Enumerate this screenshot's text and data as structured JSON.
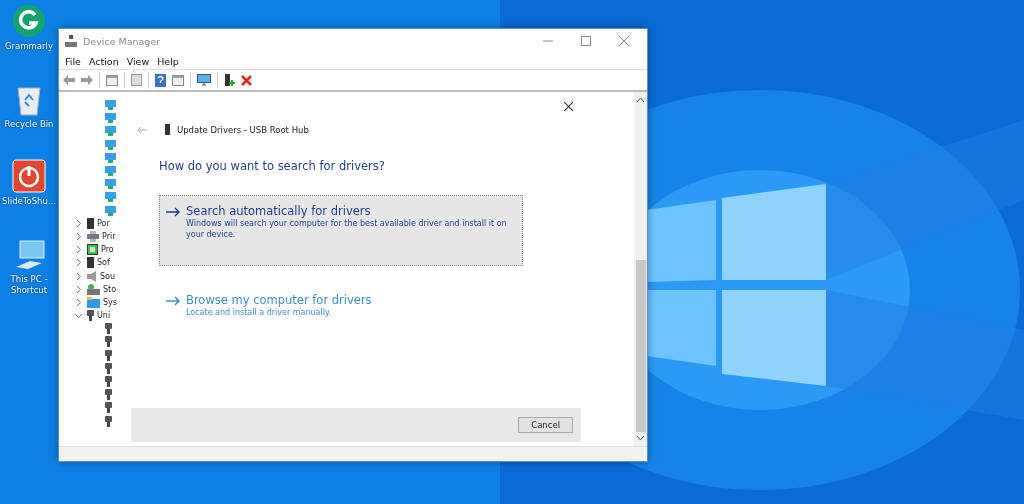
{
  "desktop_icons": [
    {
      "label": "Grammarly",
      "kind": "grammarly"
    },
    {
      "label": "Recycle Bin",
      "kind": "recycle"
    },
    {
      "label": "SlideToShu...",
      "kind": "shutdown"
    },
    {
      "label": "This PC - Shortcut",
      "kind": "pc"
    }
  ],
  "window": {
    "title": "Device Manager",
    "menu": [
      "File",
      "Action",
      "View",
      "Help"
    ],
    "tree": [
      {
        "kind": "network"
      },
      {
        "kind": "network"
      },
      {
        "kind": "network"
      },
      {
        "kind": "network"
      },
      {
        "kind": "network"
      },
      {
        "kind": "network"
      },
      {
        "kind": "network"
      },
      {
        "kind": "network"
      },
      {
        "kind": "network"
      },
      {
        "kind": "ports",
        "label": "Por",
        "expanded": false
      },
      {
        "kind": "printer",
        "label": "Prir",
        "expanded": false
      },
      {
        "kind": "cpu",
        "label": "Pro",
        "expanded": false
      },
      {
        "kind": "software",
        "label": "Sof",
        "expanded": false
      },
      {
        "kind": "sound",
        "label": "Sou",
        "expanded": false
      },
      {
        "kind": "storage",
        "label": "Sto",
        "expanded": false
      },
      {
        "kind": "system",
        "label": "Sys",
        "expanded": false
      },
      {
        "kind": "usb",
        "label": "Uni",
        "expanded": true,
        "children": [
          {
            "kind": "usb"
          },
          {
            "kind": "usb"
          },
          {
            "kind": "usb"
          },
          {
            "kind": "usb"
          },
          {
            "kind": "usb"
          },
          {
            "kind": "usb"
          },
          {
            "kind": "usb"
          },
          {
            "kind": "usb"
          }
        ]
      }
    ]
  },
  "dialog": {
    "title": "Update Drivers - USB Root Hub",
    "heading": "How do you want to search for drivers?",
    "options": [
      {
        "title": "Search automatically for drivers",
        "description": "Windows will search your computer for the best available driver and install it on your device.",
        "focused": true
      },
      {
        "title": "Browse my computer for drivers",
        "description": "Locate and install a driver manually.",
        "focused": false
      }
    ],
    "buttons": [
      "Cancel"
    ]
  }
}
